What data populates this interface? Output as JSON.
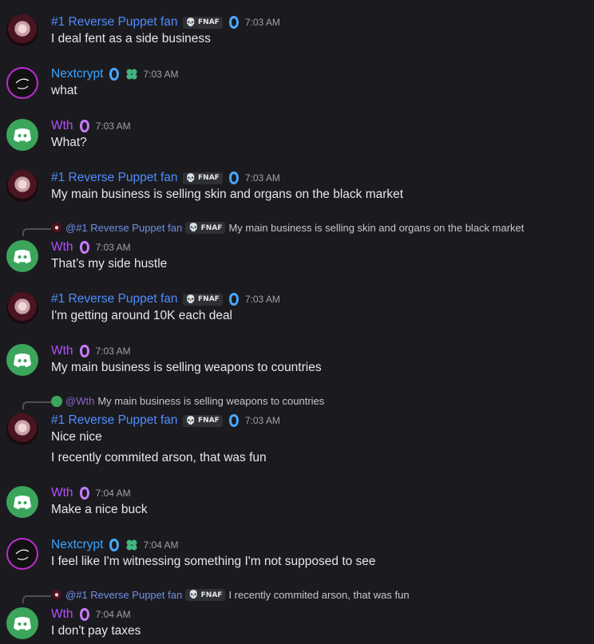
{
  "users": {
    "puppet": {
      "name": "#1 Reverse Puppet fan",
      "tag": "FNAF",
      "color": "#4f8dff"
    },
    "nextcrypt": {
      "name": "Nextcrypt",
      "color": "#3aa4ff"
    },
    "wth": {
      "name": "Wth",
      "color": "#b44dff"
    }
  },
  "messages": [
    {
      "user": "#1 Reverse Puppet fan",
      "tag": "FNAF",
      "time": "7:03 AM",
      "lines": [
        "I deal fent as a side business"
      ]
    },
    {
      "user": "Nextcrypt",
      "time": "7:03 AM",
      "lines": [
        "what"
      ]
    },
    {
      "user": "Wth",
      "time": "7:03 AM",
      "lines": [
        "What?"
      ]
    },
    {
      "user": "#1 Reverse Puppet fan",
      "tag": "FNAF",
      "time": "7:03 AM",
      "lines": [
        "My main business is selling skin and organs on the black market"
      ]
    },
    {
      "reply": {
        "mention": "@#1 Reverse Puppet fan",
        "tag": "FNAF",
        "text": "My main business is selling skin and organs on the black market"
      },
      "user": "Wth",
      "time": "7:03 AM",
      "lines": [
        "That’s my side hustle"
      ]
    },
    {
      "user": "#1 Reverse Puppet fan",
      "tag": "FNAF",
      "time": "7:03 AM",
      "lines": [
        "I'm getting around 10K each deal"
      ]
    },
    {
      "user": "Wth",
      "time": "7:03 AM",
      "lines": [
        "My main business is selling weapons to countries"
      ]
    },
    {
      "reply": {
        "mention": "@Wth",
        "text": "My main business is selling weapons to countries"
      },
      "user": "#1 Reverse Puppet fan",
      "tag": "FNAF",
      "time": "7:03 AM",
      "lines": [
        "Nice nice",
        "I recently commited arson, that was fun"
      ]
    },
    {
      "user": "Wth",
      "time": "7:04 AM",
      "lines": [
        "Make a nice buck"
      ]
    },
    {
      "user": "Nextcrypt",
      "time": "7:04 AM",
      "lines": [
        "I feel like I'm witnessing something I'm not supposed to see"
      ]
    },
    {
      "reply": {
        "mention": "@#1 Reverse Puppet fan",
        "tag": "FNAF",
        "text": "I recently commited arson, that was fun"
      },
      "user": "Wth",
      "time": "7:04 AM",
      "lines": [
        "I don't pay taxes"
      ]
    }
  ]
}
